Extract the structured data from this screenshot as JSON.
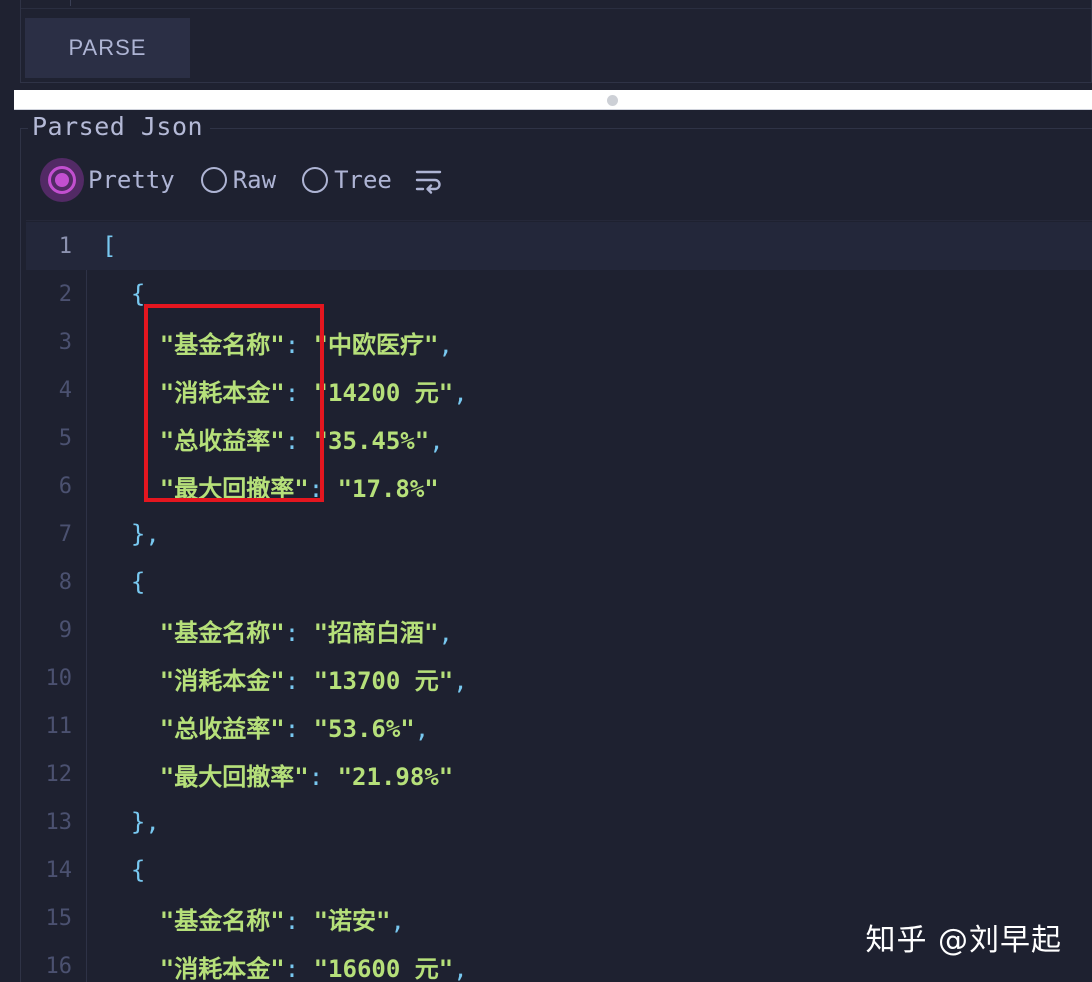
{
  "toolbar": {
    "parse_label": "PARSE"
  },
  "output": {
    "legend": "Parsed Json",
    "options": [
      {
        "label": "Pretty",
        "checked": true
      },
      {
        "label": "Raw",
        "checked": false
      },
      {
        "label": "Tree",
        "checked": false
      }
    ],
    "wrap_icon": "wrap-lines-icon"
  },
  "editor": {
    "lines": [
      {
        "num": "1",
        "indent": "",
        "parts": [
          {
            "t": "[",
            "c": "p"
          }
        ]
      },
      {
        "num": "2",
        "indent": "  ",
        "parts": [
          {
            "t": "{",
            "c": "p"
          }
        ]
      },
      {
        "num": "3",
        "indent": "    ",
        "parts": [
          {
            "t": "\"基金名称\"",
            "c": "k"
          },
          {
            "t": ": ",
            "c": "p"
          },
          {
            "t": "\"中欧医疗\"",
            "c": "s"
          },
          {
            "t": ",",
            "c": "p"
          }
        ]
      },
      {
        "num": "4",
        "indent": "    ",
        "parts": [
          {
            "t": "\"消耗本金\"",
            "c": "k"
          },
          {
            "t": ": ",
            "c": "p"
          },
          {
            "t": "\"14200 元\"",
            "c": "s"
          },
          {
            "t": ",",
            "c": "p"
          }
        ]
      },
      {
        "num": "5",
        "indent": "    ",
        "parts": [
          {
            "t": "\"总收益率\"",
            "c": "k"
          },
          {
            "t": ": ",
            "c": "p"
          },
          {
            "t": "\"35.45%\"",
            "c": "s"
          },
          {
            "t": ",",
            "c": "p"
          }
        ]
      },
      {
        "num": "6",
        "indent": "    ",
        "parts": [
          {
            "t": "\"最大回撤率\"",
            "c": "k"
          },
          {
            "t": ": ",
            "c": "p"
          },
          {
            "t": "\"17.8%\"",
            "c": "s"
          }
        ]
      },
      {
        "num": "7",
        "indent": "  ",
        "parts": [
          {
            "t": "},",
            "c": "p"
          }
        ]
      },
      {
        "num": "8",
        "indent": "  ",
        "parts": [
          {
            "t": "{",
            "c": "p"
          }
        ]
      },
      {
        "num": "9",
        "indent": "    ",
        "parts": [
          {
            "t": "\"基金名称\"",
            "c": "k"
          },
          {
            "t": ": ",
            "c": "p"
          },
          {
            "t": "\"招商白酒\"",
            "c": "s"
          },
          {
            "t": ",",
            "c": "p"
          }
        ]
      },
      {
        "num": "10",
        "indent": "    ",
        "parts": [
          {
            "t": "\"消耗本金\"",
            "c": "k"
          },
          {
            "t": ": ",
            "c": "p"
          },
          {
            "t": "\"13700 元\"",
            "c": "s"
          },
          {
            "t": ",",
            "c": "p"
          }
        ]
      },
      {
        "num": "11",
        "indent": "    ",
        "parts": [
          {
            "t": "\"总收益率\"",
            "c": "k"
          },
          {
            "t": ": ",
            "c": "p"
          },
          {
            "t": "\"53.6%\"",
            "c": "s"
          },
          {
            "t": ",",
            "c": "p"
          }
        ]
      },
      {
        "num": "12",
        "indent": "    ",
        "parts": [
          {
            "t": "\"最大回撤率\"",
            "c": "k"
          },
          {
            "t": ": ",
            "c": "p"
          },
          {
            "t": "\"21.98%\"",
            "c": "s"
          }
        ]
      },
      {
        "num": "13",
        "indent": "  ",
        "parts": [
          {
            "t": "},",
            "c": "p"
          }
        ]
      },
      {
        "num": "14",
        "indent": "  ",
        "parts": [
          {
            "t": "{",
            "c": "p"
          }
        ]
      },
      {
        "num": "15",
        "indent": "    ",
        "parts": [
          {
            "t": "\"基金名称\"",
            "c": "k"
          },
          {
            "t": ": ",
            "c": "p"
          },
          {
            "t": "\"诺安\"",
            "c": "s"
          },
          {
            "t": ",",
            "c": "p"
          }
        ]
      },
      {
        "num": "16",
        "indent": "    ",
        "parts": [
          {
            "t": "\"消耗本金\"",
            "c": "k"
          },
          {
            "t": ": ",
            "c": "p"
          },
          {
            "t": "\"16600 元\"",
            "c": "s"
          },
          {
            "t": ",",
            "c": "p"
          }
        ]
      }
    ],
    "active_line": "1"
  },
  "watermark": "知乎 @刘早起",
  "colors": {
    "background": "#1e2130",
    "accent": "#c24fd0",
    "string": "#b6e07a",
    "punct": "#78c8f0",
    "highlight": "#e4161f"
  }
}
